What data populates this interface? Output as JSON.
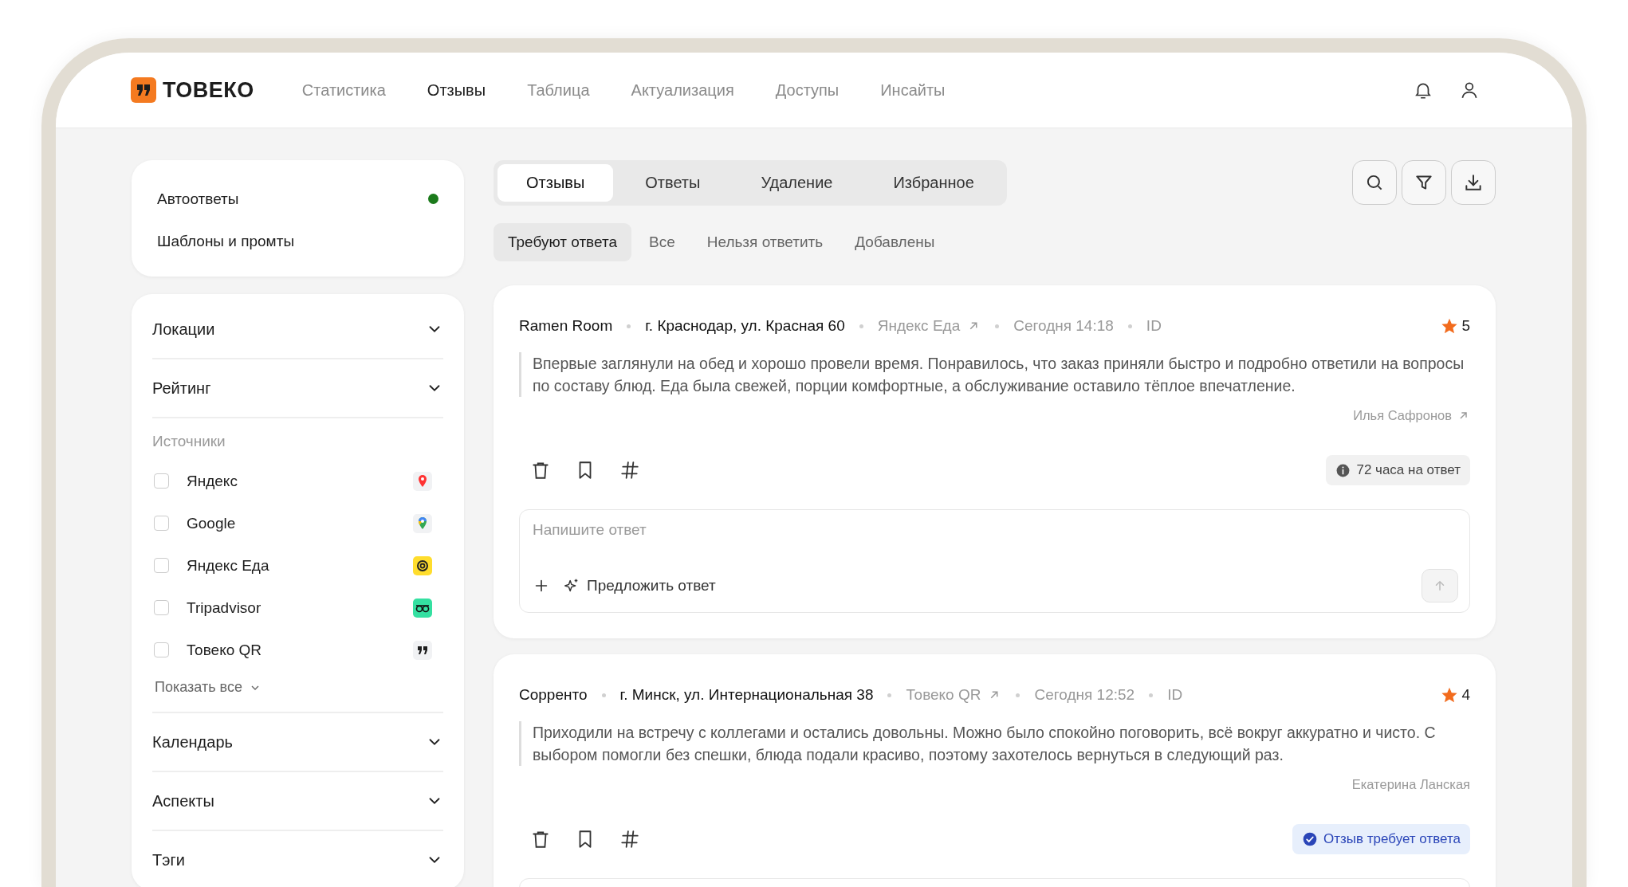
{
  "brand": {
    "name": "ТОВЕКО"
  },
  "nav": [
    {
      "label": "Статистика",
      "selected": false
    },
    {
      "label": "Отзывы",
      "selected": true
    },
    {
      "label": "Таблица",
      "selected": false
    },
    {
      "label": "Актуализация",
      "selected": false
    },
    {
      "label": "Доступы",
      "selected": false
    },
    {
      "label": "Инсайты",
      "selected": false
    }
  ],
  "sidebar": {
    "settings": [
      {
        "label": "Автоответы",
        "on": true
      },
      {
        "label": "Шаблоны и промты",
        "on": false
      }
    ],
    "filters_top": [
      {
        "title": "Локации",
        "expanded": false
      },
      {
        "title": "Рейтинг",
        "expanded": false
      }
    ],
    "sources": {
      "title": "Источники",
      "items": [
        {
          "label": "Яндекс",
          "checked": false,
          "kind": "yandex"
        },
        {
          "label": "Google",
          "checked": false,
          "kind": "google"
        },
        {
          "label": "Яндекс Еда",
          "checked": false,
          "kind": "eda"
        },
        {
          "label": "Tripadvisor",
          "checked": false,
          "kind": "tripadvisor"
        },
        {
          "label": "Товеко QR",
          "checked": false,
          "kind": "toveko"
        }
      ],
      "show_all": "Показать все"
    },
    "filters_bottom": [
      {
        "title": "Календарь",
        "expanded": false
      },
      {
        "title": "Аспекты",
        "expanded": false
      },
      {
        "title": "Тэги",
        "expanded": false
      }
    ]
  },
  "tabs": [
    {
      "label": "Отзывы",
      "selected": true
    },
    {
      "label": "Ответы",
      "selected": false
    },
    {
      "label": "Удаление",
      "selected": false
    },
    {
      "label": "Избранное",
      "selected": false
    }
  ],
  "subtabs": [
    {
      "label": "Требуют ответа",
      "selected": true
    },
    {
      "label": "Все",
      "selected": false
    },
    {
      "label": "Нельзя ответить",
      "selected": false
    },
    {
      "label": "Добавлены",
      "selected": false
    }
  ],
  "reviews": [
    {
      "place": "Ramen Room",
      "address": "г. Краснодар, ул. Красная 60",
      "source": "Яндекс Еда",
      "time": "Сегодня 14:18",
      "id": "ID",
      "rating": "5",
      "text": "Впервые заглянули на обед и хорошо провели время. Понравилось, что заказ приняли быстро и подробно ответили на вопросы по составу блюд. Еда была свежей, порции комфортные, а обслуживание оставило тёплое впечатление.",
      "author": "Илья Сафронов",
      "author_link": true,
      "status": {
        "kind": "timer",
        "text": "72 часа на ответ"
      },
      "reply": {
        "placeholder": "Напишите ответ",
        "suggest": "Предложить ответ"
      }
    },
    {
      "place": "Сорренто",
      "address": "г. Минск, ул. Интернациональная 38",
      "source": "Товеко QR",
      "time": "Сегодня 12:52",
      "id": "ID",
      "rating": "4",
      "text": "Приходили на встречу с коллегами и остались довольны. Можно было спокойно поговорить, всё вокруг аккуратно и чисто. С выбором помогли без спешки, блюда подали красиво, поэтому захотелось вернуться в следующий раз.",
      "author": "Екатерина Ланская",
      "author_link": false,
      "status": {
        "kind": "needs_reply",
        "text": "Отзыв требует ответа"
      }
    }
  ]
}
